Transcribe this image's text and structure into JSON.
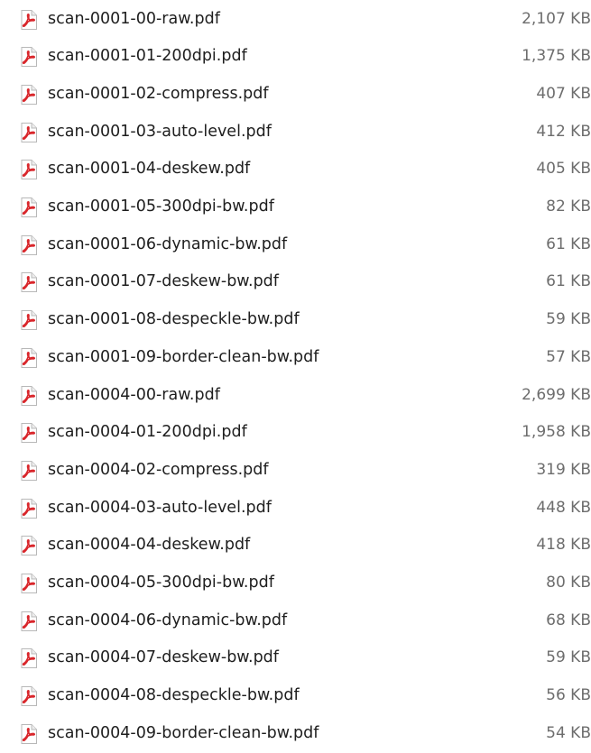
{
  "file_list": {
    "icon": "pdf-file-icon",
    "accent_color": "#d9262b",
    "files": [
      {
        "name": "scan-0001-00-raw.pdf",
        "size": "2,107 KB"
      },
      {
        "name": "scan-0001-01-200dpi.pdf",
        "size": "1,375 KB"
      },
      {
        "name": "scan-0001-02-compress.pdf",
        "size": "407 KB"
      },
      {
        "name": "scan-0001-03-auto-level.pdf",
        "size": "412 KB"
      },
      {
        "name": "scan-0001-04-deskew.pdf",
        "size": "405 KB"
      },
      {
        "name": "scan-0001-05-300dpi-bw.pdf",
        "size": "82 KB"
      },
      {
        "name": "scan-0001-06-dynamic-bw.pdf",
        "size": "61 KB"
      },
      {
        "name": "scan-0001-07-deskew-bw.pdf",
        "size": "61 KB"
      },
      {
        "name": "scan-0001-08-despeckle-bw.pdf",
        "size": "59 KB"
      },
      {
        "name": "scan-0001-09-border-clean-bw.pdf",
        "size": "57 KB"
      },
      {
        "name": "scan-0004-00-raw.pdf",
        "size": "2,699 KB"
      },
      {
        "name": "scan-0004-01-200dpi.pdf",
        "size": "1,958 KB"
      },
      {
        "name": "scan-0004-02-compress.pdf",
        "size": "319 KB"
      },
      {
        "name": "scan-0004-03-auto-level.pdf",
        "size": "448 KB"
      },
      {
        "name": "scan-0004-04-deskew.pdf",
        "size": "418 KB"
      },
      {
        "name": "scan-0004-05-300dpi-bw.pdf",
        "size": "80 KB"
      },
      {
        "name": "scan-0004-06-dynamic-bw.pdf",
        "size": "68 KB"
      },
      {
        "name": "scan-0004-07-deskew-bw.pdf",
        "size": "59 KB"
      },
      {
        "name": "scan-0004-08-despeckle-bw.pdf",
        "size": "56 KB"
      },
      {
        "name": "scan-0004-09-border-clean-bw.pdf",
        "size": "54 KB"
      }
    ]
  }
}
